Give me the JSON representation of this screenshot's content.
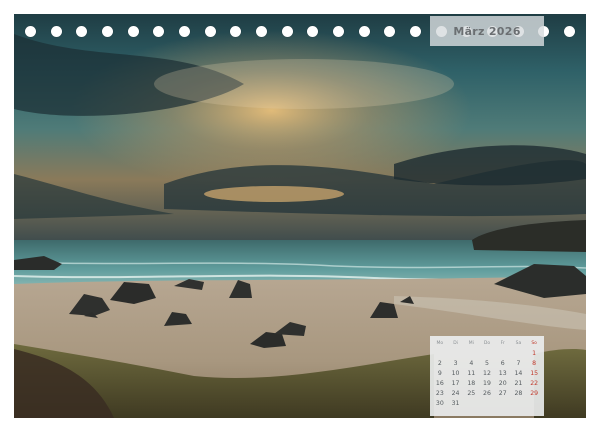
{
  "calendar": {
    "title": "März 2026",
    "weekday_headers": [
      "Mo",
      "Di",
      "Mi",
      "Do",
      "Fr",
      "Sa",
      "So"
    ],
    "rows": [
      [
        "",
        "",
        "",
        "",
        "",
        "",
        "1"
      ],
      [
        "2",
        "3",
        "4",
        "5",
        "6",
        "7",
        "8"
      ],
      [
        "9",
        "10",
        "11",
        "12",
        "13",
        "14",
        "15"
      ],
      [
        "16",
        "17",
        "18",
        "19",
        "20",
        "21",
        "22"
      ],
      [
        "23",
        "24",
        "25",
        "26",
        "27",
        "28",
        "29"
      ],
      [
        "30",
        "31",
        "",
        "",
        "",
        "",
        ""
      ]
    ],
    "sunday_color": "#c0392b"
  },
  "binding": {
    "hole_count": 22
  },
  "photo": {
    "description_icon": "beach-sunset-photo"
  }
}
